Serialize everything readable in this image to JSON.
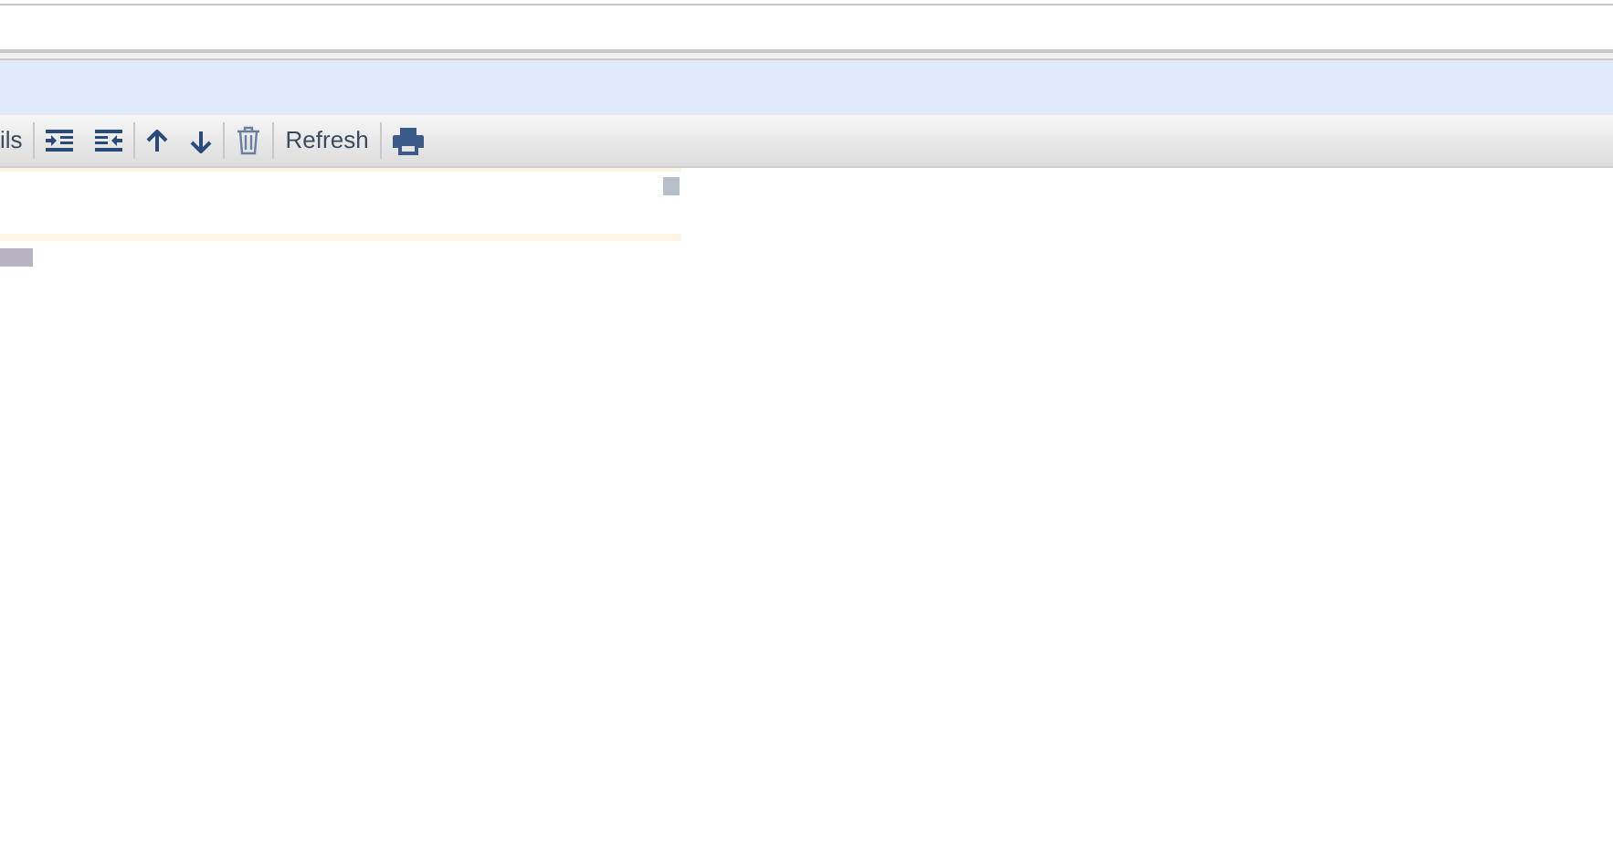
{
  "toolbar": {
    "items": [
      {
        "kind": "text",
        "label": "ils"
      },
      {
        "kind": "separator"
      },
      {
        "kind": "indent"
      },
      {
        "kind": "outdent"
      },
      {
        "kind": "separator"
      },
      {
        "kind": "up"
      },
      {
        "kind": "down"
      },
      {
        "kind": "separator"
      },
      {
        "kind": "trash"
      },
      {
        "kind": "separator"
      },
      {
        "kind": "text",
        "label": "Refresh"
      },
      {
        "kind": "separator"
      },
      {
        "kind": "print"
      }
    ]
  }
}
